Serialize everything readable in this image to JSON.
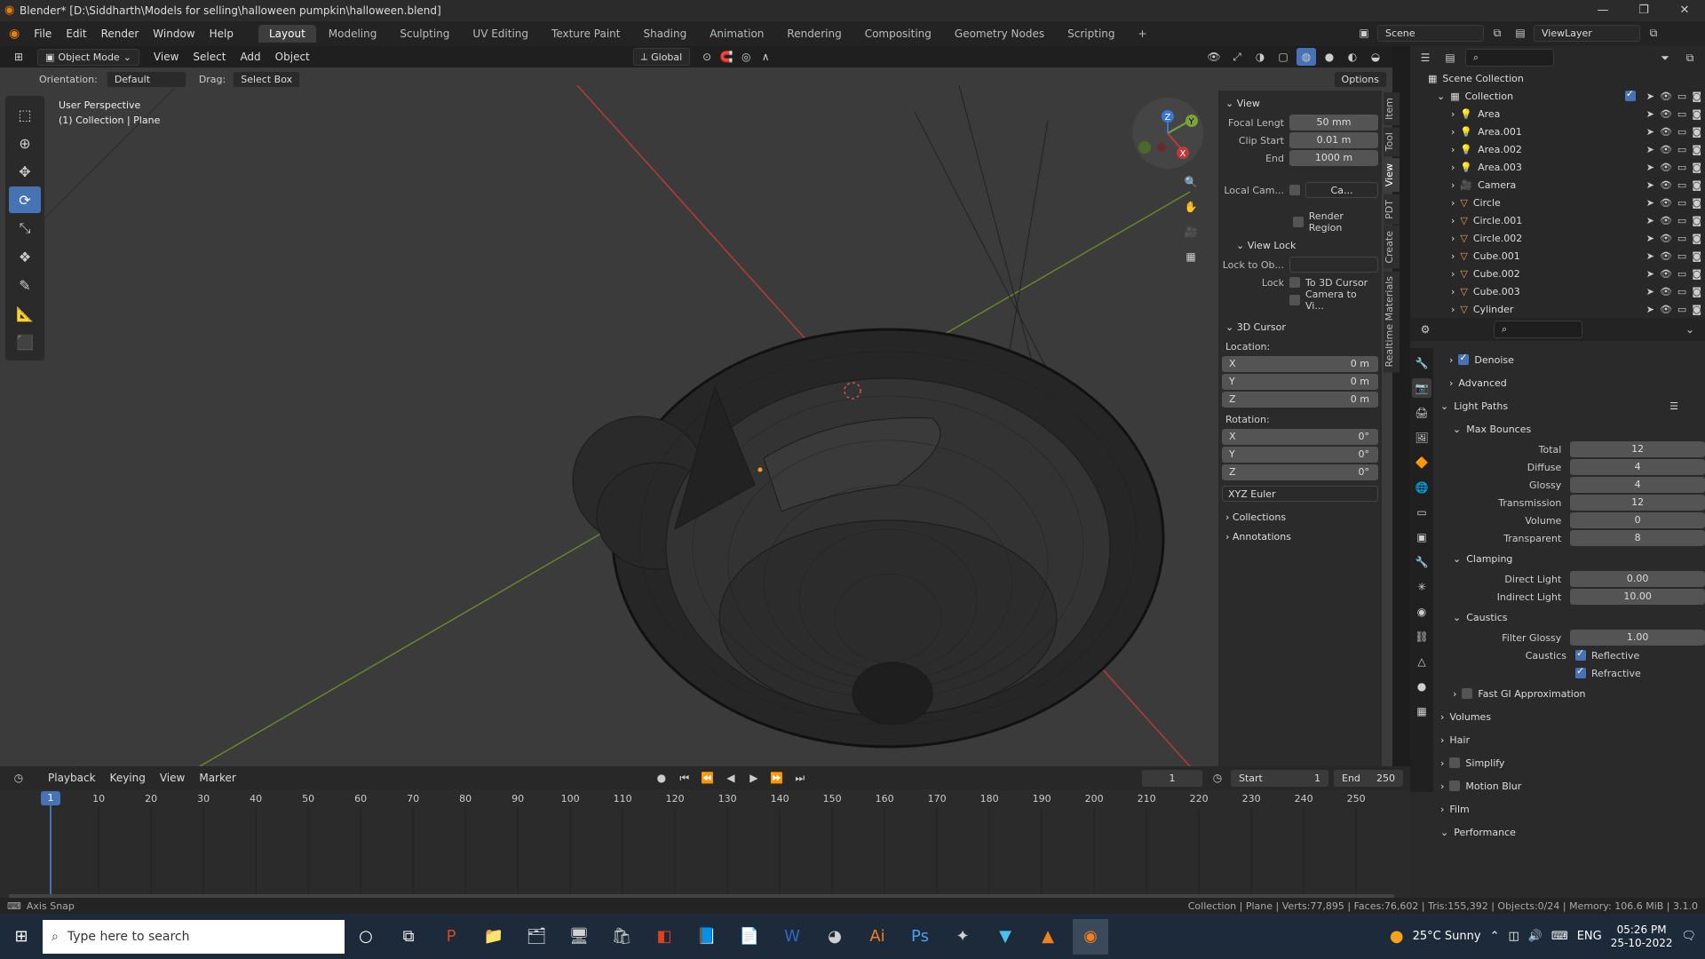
{
  "window": {
    "title": "Blender* [D:\\Siddharth\\Models for selling\\halloween pumpkin\\halloween.blend]",
    "minimize": "—",
    "maximize": "❐",
    "close": "✕"
  },
  "menu": [
    "File",
    "Edit",
    "Render",
    "Window",
    "Help"
  ],
  "workspaces": [
    "Layout",
    "Modeling",
    "Sculpting",
    "UV Editing",
    "Texture Paint",
    "Shading",
    "Animation",
    "Rendering",
    "Compositing",
    "Geometry Nodes",
    "Scripting",
    "+"
  ],
  "scene": {
    "label": "Scene",
    "viewlayer": "ViewLayer"
  },
  "viewport_header": {
    "mode": "Object Mode",
    "menus": [
      "View",
      "Select",
      "Add",
      "Object"
    ],
    "transform": "Global"
  },
  "tool_header": {
    "orientation_label": "Orientation:",
    "orientation": "Default",
    "drag_label": "Drag:",
    "drag": "Select Box",
    "options": "Options"
  },
  "overlay_text": {
    "line1": "User Perspective",
    "line2": "(1) Collection | Plane"
  },
  "n_panel": {
    "view_title": "View",
    "focal_label": "Focal Lengt",
    "focal": "50 mm",
    "clip_start_label": "Clip Start",
    "clip_start": "0.01 m",
    "end_label": "End",
    "end": "1000 m",
    "local_cam_label": "Local Cam...",
    "local_cam": "Ca...",
    "render_region": "Render Region",
    "view_lock_title": "View Lock",
    "lock_to_label": "Lock to Ob...",
    "lock_label": "Lock",
    "to_cursor": "To 3D Cursor",
    "cam_to_view": "Camera to Vi...",
    "cursor_title": "3D Cursor",
    "location_label": "Location:",
    "rotation_label": "Rotation:",
    "loc": [
      {
        "axis": "X",
        "val": "0 m"
      },
      {
        "axis": "Y",
        "val": "0 m"
      },
      {
        "axis": "Z",
        "val": "0 m"
      }
    ],
    "rot": [
      {
        "axis": "X",
        "val": "0°"
      },
      {
        "axis": "Y",
        "val": "0°"
      },
      {
        "axis": "Z",
        "val": "0°"
      }
    ],
    "euler": "XYZ Euler",
    "collections": "Collections",
    "annotations": "Annotations",
    "tabs": [
      "Item",
      "Tool",
      "View",
      "PDT",
      "Create",
      "Realtime Materials"
    ]
  },
  "outliner": {
    "root": "Scene Collection",
    "collection": "Collection",
    "items": [
      "Area",
      "Area.001",
      "Area.002",
      "Area.003",
      "Camera",
      "Circle",
      "Circle.001",
      "Circle.002",
      "Cube.001",
      "Cube.002",
      "Cube.003",
      "Cylinder"
    ]
  },
  "properties": {
    "denoise": "Denoise",
    "advanced": "Advanced",
    "light_paths": "Light Paths",
    "max_bounces": "Max Bounces",
    "bounces": [
      {
        "label": "Total",
        "val": "12"
      },
      {
        "label": "Diffuse",
        "val": "4"
      },
      {
        "label": "Glossy",
        "val": "4"
      },
      {
        "label": "Transmission",
        "val": "12"
      },
      {
        "label": "Volume",
        "val": "0"
      },
      {
        "label": "Transparent",
        "val": "8"
      }
    ],
    "clamping": "Clamping",
    "clamp": [
      {
        "label": "Direct Light",
        "val": "0.00"
      },
      {
        "label": "Indirect Light",
        "val": "10.00"
      }
    ],
    "caustics": "Caustics",
    "filter_glossy_label": "Filter Glossy",
    "filter_glossy": "1.00",
    "caustics_label": "Caustics",
    "reflective": "Reflective",
    "refractive": "Refractive",
    "fast_gi": "Fast GI Approximation",
    "volumes": "Volumes",
    "hair": "Hair",
    "simplify": "Simplify",
    "motion_blur": "Motion Blur",
    "film": "Film",
    "performance": "Performance"
  },
  "timeline": {
    "menus": [
      "Playback",
      "Keying",
      "View",
      "Marker"
    ],
    "current": "1",
    "start_label": "Start",
    "start": "1",
    "end_label": "End",
    "end": "250",
    "ticks": [
      "10",
      "20",
      "30",
      "40",
      "50",
      "60",
      "70",
      "80",
      "90",
      "100",
      "110",
      "120",
      "130",
      "140",
      "150",
      "160",
      "170",
      "180",
      "190",
      "200",
      "210",
      "220",
      "230",
      "240",
      "250"
    ],
    "frame_marker": "1"
  },
  "status": {
    "left": "Axis Snap",
    "right": "Collection | Plane | Verts:77,895 | Faces:76,602 | Tris:155,392 | Objects:0/24 | Memory: 106.6 MiB | 3.1.0"
  },
  "taskbar": {
    "search": "Type here to search",
    "weather": "25°C  Sunny",
    "lang": "ENG",
    "time": "05:26 PM",
    "date": "25-10-2022"
  },
  "colors": {
    "accent": "#4772b3",
    "x_axis": "#c03a3a",
    "y_axis": "#7aa33a",
    "z_axis": "#3a78d6"
  }
}
